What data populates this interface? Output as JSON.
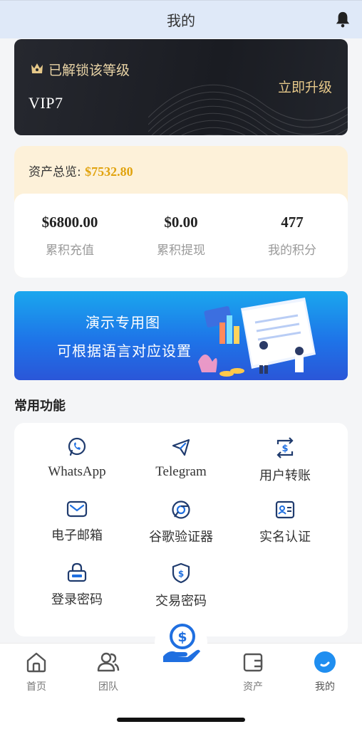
{
  "header": {
    "title": "我的",
    "bell_icon": "bell-icon"
  },
  "vip": {
    "unlocked_text": "已解锁该等级",
    "level": "VIP7",
    "upgrade_label": "立即升级",
    "crown_icon": "crown-icon"
  },
  "assets": {
    "overview_label": "资产总览:",
    "overview_amount": "$7532.80",
    "stats": [
      {
        "value": "$6800.00",
        "label": "累积充值"
      },
      {
        "value": "$0.00",
        "label": "累积提现"
      },
      {
        "value": "477",
        "label": "我的积分"
      }
    ]
  },
  "banner": {
    "line1": "演示专用图",
    "line2": "可根据语言对应设置"
  },
  "functions": {
    "title": "常用功能",
    "items": [
      {
        "label": "WhatsApp",
        "icon": "whatsapp-icon"
      },
      {
        "label": "Telegram",
        "icon": "telegram-icon"
      },
      {
        "label": "用户转账",
        "icon": "transfer-icon"
      },
      {
        "label": "电子邮箱",
        "icon": "mail-icon"
      },
      {
        "label": "谷歌验证器",
        "icon": "google-auth-icon"
      },
      {
        "label": "实名认证",
        "icon": "id-card-icon"
      },
      {
        "label": "登录密码",
        "icon": "lock-icon"
      },
      {
        "label": "交易密码",
        "icon": "shield-dollar-icon"
      }
    ]
  },
  "tabbar": {
    "items": [
      {
        "label": "首页",
        "icon": "home-icon"
      },
      {
        "label": "团队",
        "icon": "team-icon"
      },
      {
        "label": "资产",
        "icon": "wallet-icon"
      },
      {
        "label": "我的",
        "icon": "profile-icon"
      }
    ],
    "center_icon": "money-hand-icon"
  },
  "colors": {
    "accent": "#1f6fe0",
    "gold": "#e1a30e",
    "vip_gold": "#e6c889",
    "header_bg": "#dfe9f8"
  }
}
